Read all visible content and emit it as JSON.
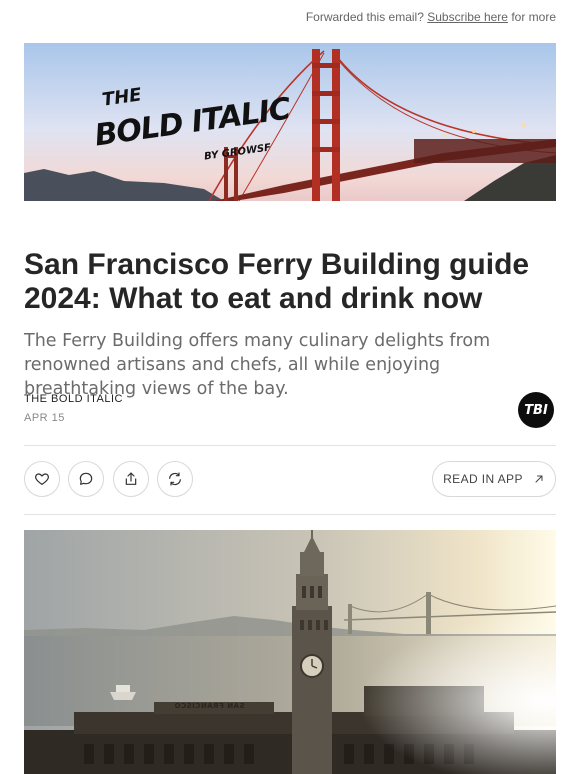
{
  "topbar": {
    "prefix": "Forwarded this email?",
    "link": "Subscribe here",
    "suffix": "for more"
  },
  "banner": {
    "logo_line1": "THE",
    "logo_line2": "BOLD ITALIC",
    "logo_line3": "BY GROWSF"
  },
  "post": {
    "title": "San Francisco Ferry Building guide 2024: What to eat and drink now",
    "subtitle": "The Ferry Building offers many culinary delights from renowned artisans and chefs, all while enjoying breathtaking views of the bay.",
    "author": "THE BOLD ITALIC",
    "date": "APR 15",
    "avatar_text": "TBI"
  },
  "actions": {
    "icons": [
      "heart-icon",
      "comment-icon",
      "share-icon",
      "restack-icon"
    ],
    "read_label": "READ IN APP"
  },
  "hero": {
    "sign_text": "SAN FRANCISCO"
  }
}
